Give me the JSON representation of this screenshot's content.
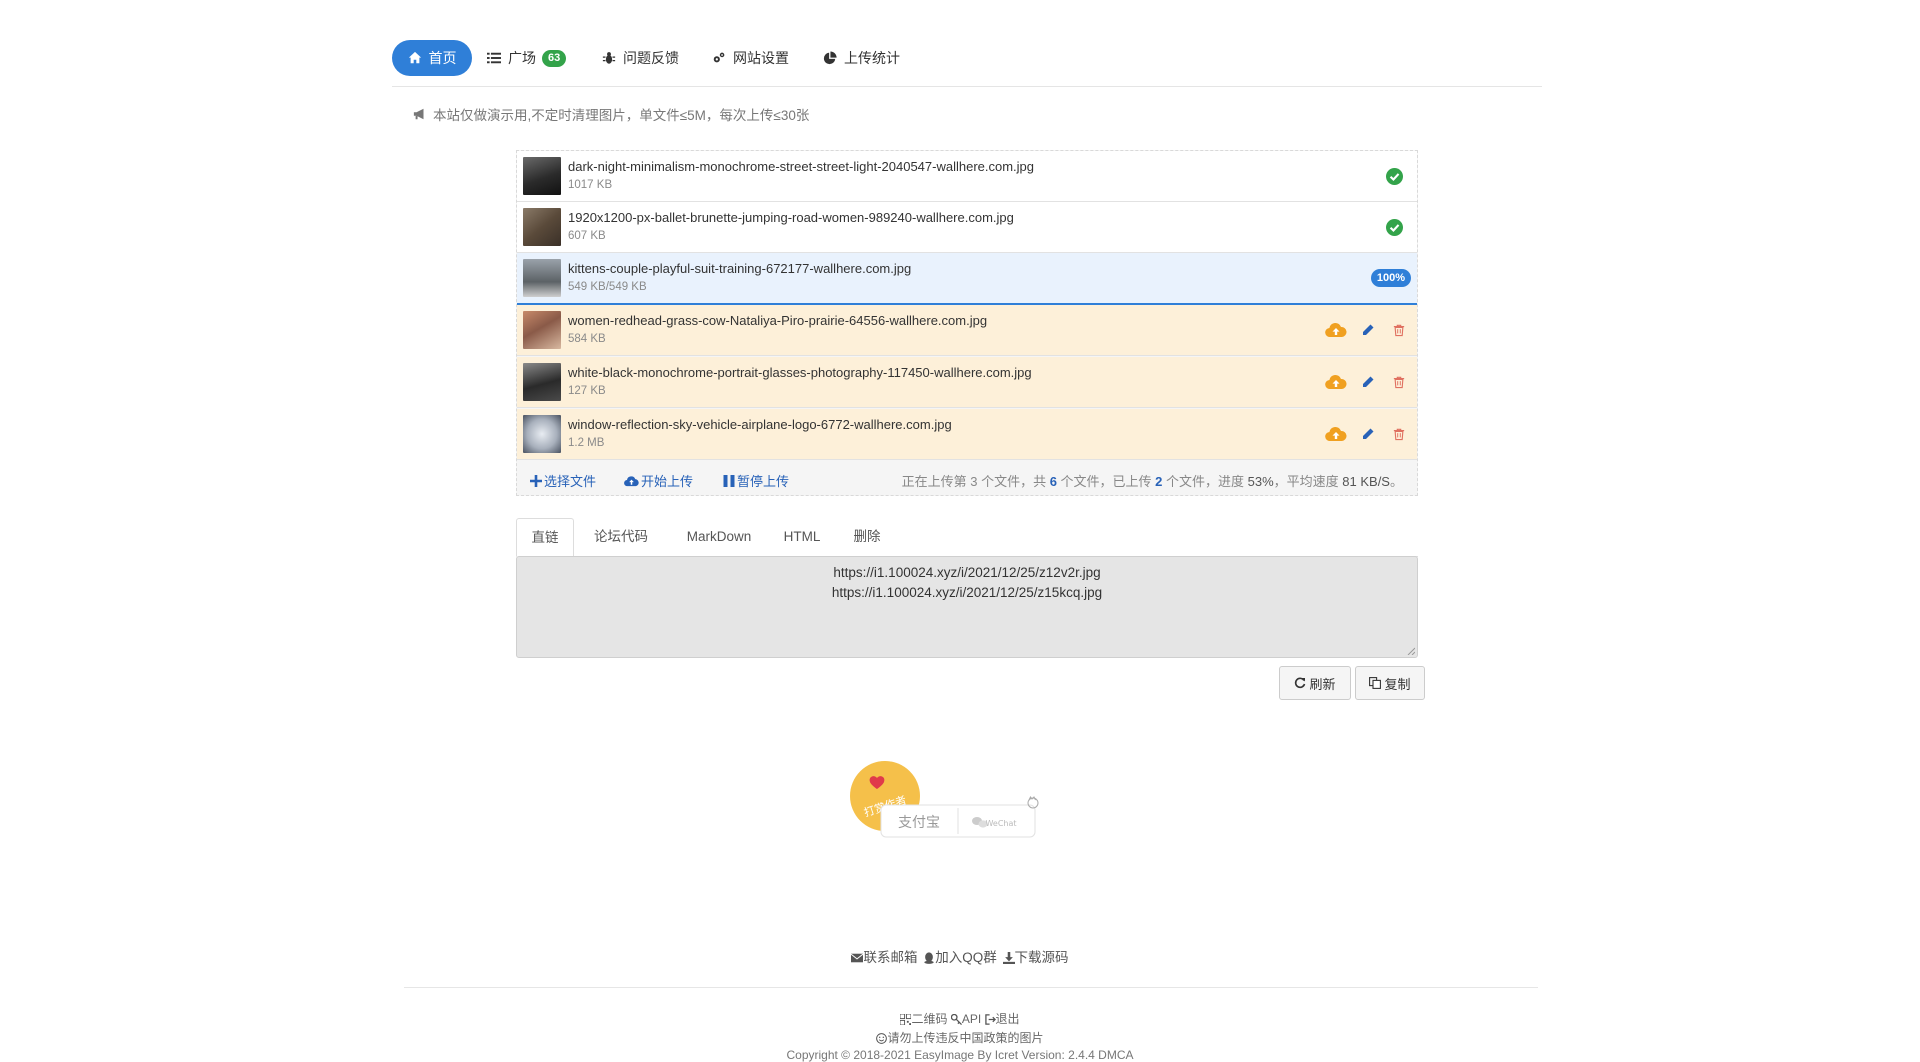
{
  "nav": {
    "home": "首页",
    "square": "广场",
    "square_count": "63",
    "feedback": "问题反馈",
    "settings": "网站设置",
    "stats": "上传统计"
  },
  "notice": "本站仅做演示用,不定时清理图片，单文件≤5M，每次上传≤30张",
  "files": [
    {
      "name": "dark-night-minimalism-monochrome-street-street-light-2040547-wallhere.com.jpg",
      "size": "1017 KB",
      "state": "done"
    },
    {
      "name": "1920x1200-px-ballet-brunette-jumping-road-women-989240-wallhere.com.jpg",
      "size": "607 KB",
      "state": "done"
    },
    {
      "name": "kittens-couple-playful-suit-training-672177-wallhere.com.jpg",
      "size": "549 KB/549 KB",
      "state": "uploading",
      "progress": "100%"
    },
    {
      "name": "women-redhead-grass-cow-Nataliya-Piro-prairie-64556-wallhere.com.jpg",
      "size": "584 KB",
      "state": "pending"
    },
    {
      "name": "white-black-monochrome-portrait-glasses-photography-117450-wallhere.com.jpg",
      "size": "127 KB",
      "state": "pending"
    },
    {
      "name": "window-reflection-sky-vehicle-airplane-logo-6772-wallhere.com.jpg",
      "size": "1.2 MB",
      "state": "pending"
    }
  ],
  "uploader": {
    "pick": "选择文件",
    "start": "开始上传",
    "pause": "暂停上传",
    "status_a": "正在上传第 3 个文件，共 ",
    "status_total": "6",
    "status_b": " 个文件，已上传 ",
    "status_done": "2",
    "status_c": " 个文件，进度 ",
    "status_pct": "53%",
    "status_d": "，平均速度 ",
    "status_speed": "81 KB/S",
    "status_e": "。"
  },
  "tabs": [
    "直链",
    "论坛代码",
    "MarkDown",
    "HTML",
    "删除"
  ],
  "links": [
    "https://i1.100024.xyz/i/2021/12/25/z12v2r.jpg",
    "https://i1.100024.xyz/i/2021/12/25/z15kcq.jpg"
  ],
  "buttons": {
    "refresh": "刷新",
    "copy": "复制"
  },
  "donate": {
    "badge": "打赏作者",
    "alipay": "支付宝",
    "wechat": "WeChat"
  },
  "footer": {
    "email": "联系邮箱",
    "qq": "加入QQ群",
    "source": "下载源码",
    "qrcode": "二维码",
    "api": "API",
    "logout": "退出",
    "warning": "请勿上传违反中国政策的图片",
    "copyright": "Copyright © 2018-2021 EasyImage By Icret Version: 2.4.4 DMCA"
  },
  "colors": {
    "accent": "#2f7fd8",
    "success": "#33a34a",
    "pending_bg": "#fdf0d9",
    "upload_orange": "#f0a020",
    "delete_red": "#e07060"
  }
}
